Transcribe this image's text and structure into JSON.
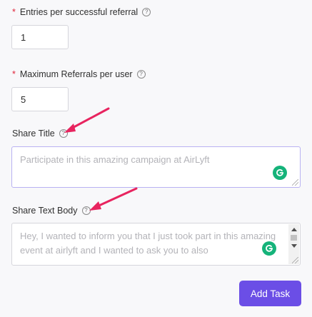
{
  "fields": {
    "entries": {
      "required_mark": "*",
      "label": "Entries per successful referral",
      "value": "1"
    },
    "max_referrals": {
      "required_mark": "*",
      "label": "Maximum Referrals per user",
      "value": "5"
    },
    "share_title": {
      "label": "Share Title",
      "placeholder": "Participate in this amazing campaign at AirLyft"
    },
    "share_text": {
      "label": "Share Text Body",
      "placeholder": "Hey, I wanted to inform you that I just took part in this amazing event at airlyft and I wanted to ask you to also"
    }
  },
  "help_glyph": "?",
  "actions": {
    "add_task_label": "Add Task"
  },
  "colors": {
    "required": "#e0243a",
    "button": "#6b4ee6",
    "annotation_arrow": "#e8245f",
    "grammarly": "#15b37a"
  },
  "icons": [
    "help-icon",
    "grammarly-icon",
    "resize-handle-icon",
    "annotation-arrow-icon"
  ]
}
